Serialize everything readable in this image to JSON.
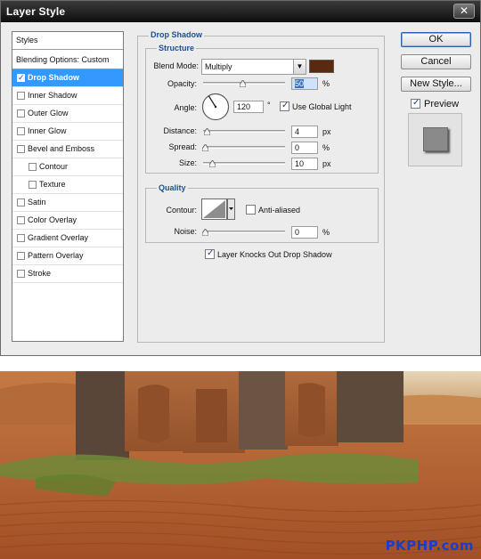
{
  "window": {
    "title": "Layer Style",
    "close_glyph": "✕"
  },
  "styles_panel": {
    "header": "Styles",
    "blending_options": "Blending Options: Custom",
    "items": [
      {
        "label": "Drop Shadow",
        "checked": true,
        "selected": true,
        "indent": false
      },
      {
        "label": "Inner Shadow",
        "checked": false,
        "selected": false,
        "indent": false
      },
      {
        "label": "Outer Glow",
        "checked": false,
        "selected": false,
        "indent": false
      },
      {
        "label": "Inner Glow",
        "checked": false,
        "selected": false,
        "indent": false
      },
      {
        "label": "Bevel and Emboss",
        "checked": false,
        "selected": false,
        "indent": false
      },
      {
        "label": "Contour",
        "checked": false,
        "selected": false,
        "indent": true
      },
      {
        "label": "Texture",
        "checked": false,
        "selected": false,
        "indent": true
      },
      {
        "label": "Satin",
        "checked": false,
        "selected": false,
        "indent": false
      },
      {
        "label": "Color Overlay",
        "checked": false,
        "selected": false,
        "indent": false
      },
      {
        "label": "Gradient Overlay",
        "checked": false,
        "selected": false,
        "indent": false
      },
      {
        "label": "Pattern Overlay",
        "checked": false,
        "selected": false,
        "indent": false
      },
      {
        "label": "Stroke",
        "checked": false,
        "selected": false,
        "indent": false
      }
    ]
  },
  "drop_shadow": {
    "section_title": "Drop Shadow",
    "structure_title": "Structure",
    "blend_mode_label": "Blend Mode:",
    "blend_mode_value": "Multiply",
    "shadow_color": "#5a2a10",
    "opacity_label": "Opacity:",
    "opacity_value": "50",
    "opacity_unit": "%",
    "angle_label": "Angle:",
    "angle_value": "120",
    "angle_unit": "°",
    "use_global_light_label": "Use Global Light",
    "use_global_light_checked": true,
    "distance_label": "Distance:",
    "distance_value": "4",
    "distance_unit": "px",
    "spread_label": "Spread:",
    "spread_value": "0",
    "spread_unit": "%",
    "size_label": "Size:",
    "size_value": "10",
    "size_unit": "px",
    "quality_title": "Quality",
    "contour_label": "Contour:",
    "anti_aliased_label": "Anti-aliased",
    "anti_aliased_checked": false,
    "noise_label": "Noise:",
    "noise_value": "0",
    "noise_unit": "%",
    "knockout_label": "Layer Knocks Out Drop Shadow",
    "knockout_checked": true
  },
  "buttons": {
    "ok": "OK",
    "cancel": "Cancel",
    "new_style": "New Style...",
    "preview_label": "Preview",
    "preview_checked": true
  },
  "photo": {
    "watermark": "PKPHP.com"
  },
  "colors": {
    "selection": "#3399ff",
    "group_title": "#1d4f91",
    "watermark": "#1d3cc8"
  }
}
